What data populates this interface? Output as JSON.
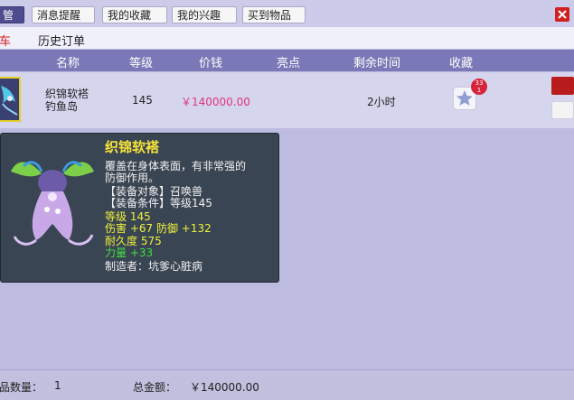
{
  "tabs": [
    "管理",
    "消息提醒",
    "我的收藏",
    "我的兴趣",
    "买到物品"
  ],
  "sub_tabs": [
    "车",
    "历史订单"
  ],
  "columns": [
    "名称",
    "等级",
    "价钱",
    "亮点",
    "剩余时间",
    "收藏"
  ],
  "row": {
    "name": "织锦软褡",
    "location": "钓鱼岛",
    "level": "145",
    "price": "￥140000.00",
    "time_left": "2小时",
    "fav_count": "33",
    "fav_extra": "1"
  },
  "tooltip": {
    "title": "织锦软褡",
    "desc_1": "覆盖在身体表面，有非常强的",
    "desc_2": "防御作用。",
    "target": "【装备对象】召唤兽",
    "condition": "【装备条件】等级145",
    "level": "等级 145",
    "stats": "伤害 +67 防御 +132",
    "durability": "耐久度 575",
    "bonus": "力量 +33",
    "maker": "制造者：坑爹心脏病"
  },
  "footer": {
    "count_label": "品数量：",
    "count": "1",
    "total_label": "总金额：",
    "total": "￥140000.00"
  },
  "colors": {
    "accent": "#4e4c8e",
    "header": "#7a78b6",
    "price": "#e0347a",
    "tooltip_bg": "#3a4553"
  },
  "icons": [
    "star-icon",
    "close-icon",
    "item-icon",
    "pet-armor-icon"
  ]
}
